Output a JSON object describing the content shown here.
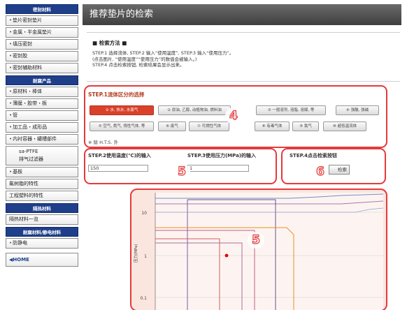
{
  "sidebar": {
    "section1": "密封材料",
    "group1": [
      "垫片密封垫片",
      "金属・半金属垫片",
      "填压密封",
      "密封胶",
      "密封辅助材料"
    ],
    "section2": "耐腐产品",
    "group2": [
      "原材料・棒体",
      "薄膜・胶带・板",
      "管",
      "加工品・成形品",
      "内衬容器・罐槽部件"
    ],
    "ptfe_item": "sa-PTFE\n排气过滤器",
    "group3": [
      "基板",
      "氟树脂的特性",
      "工程塑料的特性"
    ],
    "section3": "隔热材料",
    "group4": [
      "隔热材料一览"
    ],
    "section4": "耐腐材料/静电材料",
    "group5": [
      "防静电"
    ],
    "home": "◀HOME"
  },
  "main": {
    "title": "推荐垫片的检索",
    "method_title": "■ 检索方法 ■",
    "method_lines": [
      "STEP.1 选择流体, STEP.2 输入“使用温度”, STEP.3 输入“使用压力”。",
      "(点击图片, “使用温度”“使用压力”的数值会被输入。)",
      "STEP.4 点击检索按钮, 检索结果会显示出来。"
    ]
  },
  "step1": {
    "title": "STEP.1流体区分的选择",
    "row1": [
      "① 水, 热水, 水蒸气",
      "② 原油, 乙醇, 动植物油, 燃料油",
      "③ 一般溶剂, 溶脂, 溶媒, 等",
      "④ 强酸, 强碱"
    ],
    "row2": [
      "⑤ 空气, 氮气, 惰性气体, 等",
      "⑥ 废气",
      "⑦ 可燃性气体",
      "⑧ 有毒气体",
      "⑨ 氯气",
      "⑩ 超低温流体"
    ],
    "note": "※ 除 H.T.S. 外"
  },
  "step2": {
    "title": "STEP.2使用温度(℃)的输入",
    "value": "150"
  },
  "step3": {
    "title": "STEP.3使用压力(MPa)的输入",
    "value": "1"
  },
  "step4": {
    "title": "STEP.4点击检索按钮",
    "button": "检索"
  },
  "badges": [
    "4",
    "5",
    "6",
    "5"
  ],
  "chart_data": {
    "type": "line",
    "ylabel": "压力(MPa)",
    "y_ticks": [
      "10",
      "1",
      "0.1"
    ],
    "y_scale": "log",
    "selected_point": {
      "y": 1
    }
  },
  "colors": {
    "accent": "#e43a3a",
    "nav": "#1f3f8a",
    "active": "#d9412a"
  }
}
